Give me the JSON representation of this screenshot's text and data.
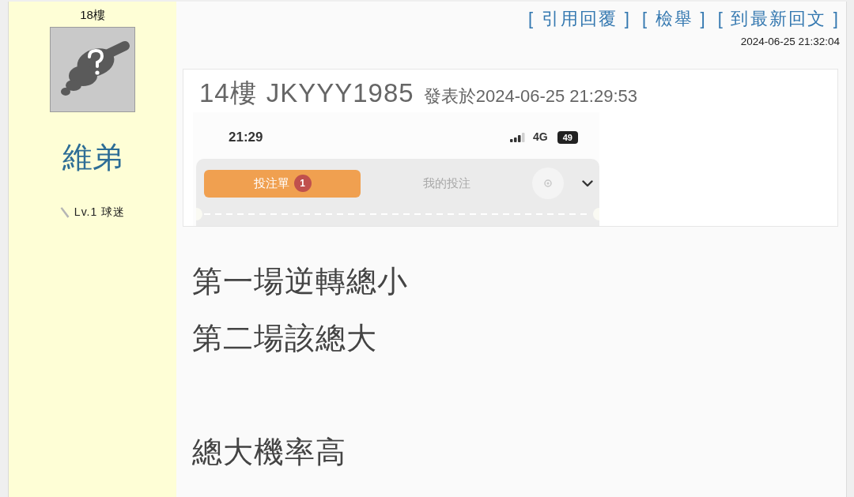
{
  "post": {
    "floor": "18樓",
    "author": {
      "name": "維弟",
      "rank": "Lv.1 球迷"
    },
    "actions": [
      {
        "label": "[ 引用回覆 ]"
      },
      {
        "label": "[ 檢舉 ]"
      },
      {
        "label": "[ 到最新回文 ]"
      }
    ],
    "timestamp": "2024-06-25 21:32:04",
    "quote": {
      "floor": "14樓",
      "author": "JKYYY1985",
      "posted": "發表於2024-06-25 21:29:53",
      "screenshot": {
        "status_bar": {
          "time": "21:29",
          "network": "4G",
          "battery": "49"
        },
        "tabs": [
          {
            "label": "投注單",
            "badge": "1",
            "selected": true
          },
          {
            "label": "我的投注",
            "selected": false
          }
        ]
      }
    },
    "body": [
      {
        "lines": [
          "第一場逆轉總小",
          "第二場該總大"
        ]
      },
      {
        "lines": [
          "總大機率高"
        ]
      }
    ]
  }
}
